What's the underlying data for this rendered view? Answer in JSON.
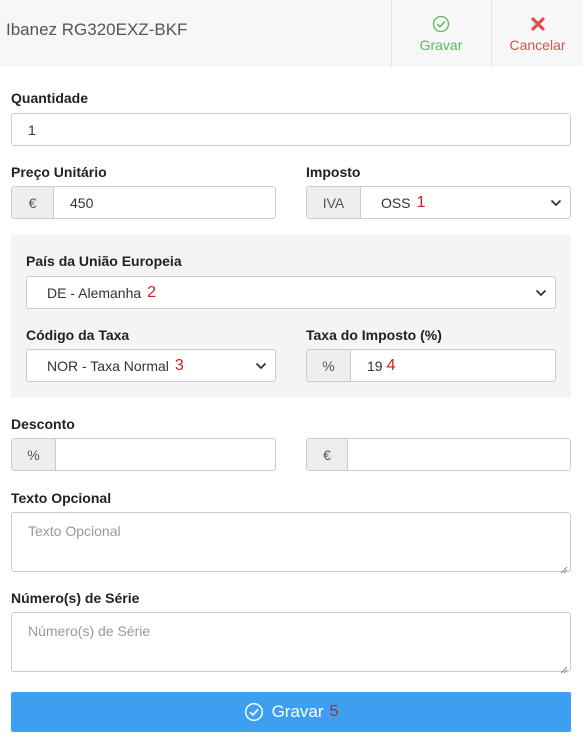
{
  "header": {
    "title": "Ibanez RG320EXZ-BKF",
    "save_label": "Gravar",
    "cancel_label": "Cancelar"
  },
  "form": {
    "quantity": {
      "label": "Quantidade",
      "value": "1"
    },
    "unit_price": {
      "label": "Preço Unitário",
      "currency": "€",
      "value": "450"
    },
    "tax": {
      "label": "Imposto",
      "addon": "IVA",
      "selected": "OSS",
      "marker": "1"
    },
    "eu_panel": {
      "country": {
        "label": "País da União Europeia",
        "selected": "DE - Alemanha",
        "marker": "2"
      },
      "rate_code": {
        "label": "Código da Taxa",
        "selected": "NOR - Taxa Normal",
        "marker": "3"
      },
      "tax_rate": {
        "label": "Taxa do Imposto (%)",
        "addon": "%",
        "value": "19",
        "marker": "4"
      }
    },
    "discount": {
      "label": "Desconto",
      "percent_addon": "%",
      "percent_value": "",
      "amount_addon": "€",
      "amount_value": ""
    },
    "optional_text": {
      "label": "Texto Opcional",
      "placeholder": "Texto Opcional"
    },
    "serial_numbers": {
      "label": "Número(s) de Série",
      "placeholder": "Número(s) de Série"
    },
    "submit": {
      "label": "Gravar",
      "marker": "5"
    }
  },
  "icons": {
    "header_save": "check-circle-icon",
    "header_cancel": "close-icon",
    "submit": "check-circle-icon"
  },
  "colors": {
    "save_green": "#5cb85c",
    "cancel_red": "#d9534f",
    "submit_blue": "#3c9ff0",
    "marker_red": "#d12020"
  }
}
